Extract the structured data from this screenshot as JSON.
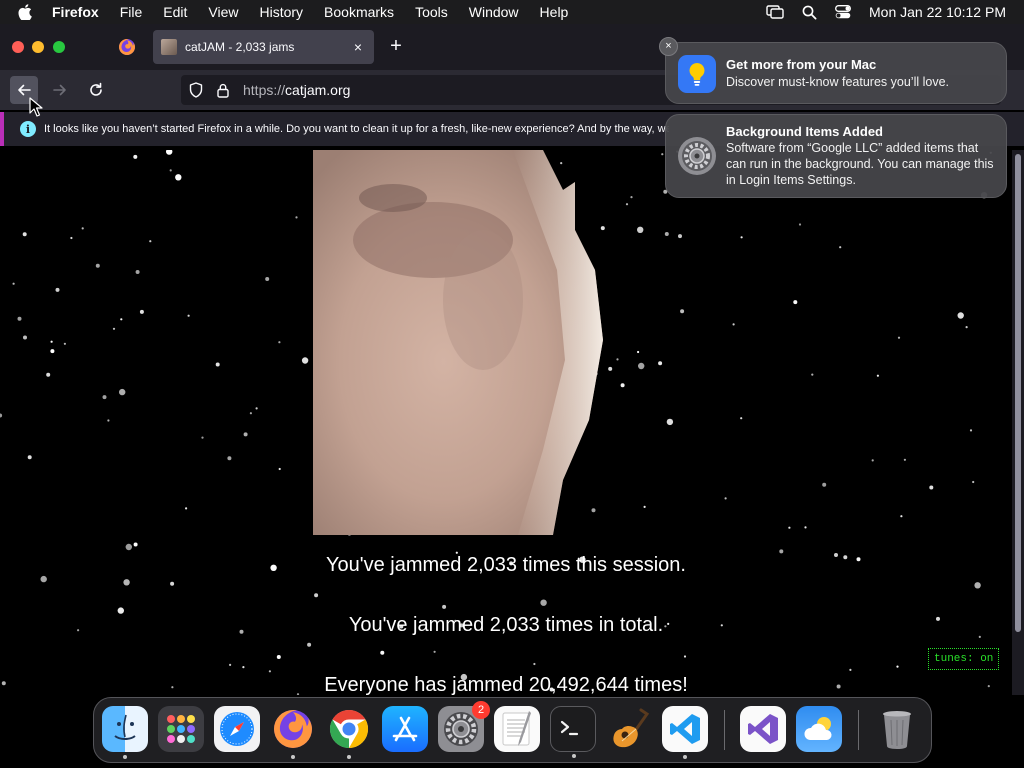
{
  "menubar": {
    "app_name": "Firefox",
    "menus": [
      "File",
      "Edit",
      "View",
      "History",
      "Bookmarks",
      "Tools",
      "Window",
      "Help"
    ],
    "clock": "Mon Jan 22  10:12 PM",
    "status_icons": [
      "screen-mirroring-icon",
      "spotlight-search-icon",
      "control-center-icon"
    ]
  },
  "browser": {
    "tab_title": "catJAM - 2,033 jams",
    "tab_close": "×",
    "new_tab": "+",
    "url_scheme": "https://",
    "url_host": "catjam.org",
    "info_icon": "i",
    "info_message": "It looks like you haven’t started Firefox in a while. Do you want to clean it up for a fresh, like-new experience? And by the way, welcome back!"
  },
  "page": {
    "session_text": "You've jammed 2,033 times this session.",
    "total_text": "You've jammed 2,033 times in total.",
    "everyone_text": "Everyone has jammed 20,492,644 times!",
    "tunes_label": "tunes: on"
  },
  "notifications": [
    {
      "title": "Get more from your Mac",
      "body": "Discover must-know features you’ll love.",
      "icon": "lightbulb-icon"
    },
    {
      "title": "Background Items Added",
      "body": "Software from “Google LLC” added items that can run in the background. You can manage this in Login Items Settings.",
      "icon": "system-settings-gear-icon"
    }
  ],
  "notification_close": "×",
  "dock": {
    "items": [
      "Finder",
      "Launchpad",
      "Safari",
      "Firefox",
      "Google Chrome",
      "App Store",
      "System Settings",
      "TextEdit",
      "Terminal",
      "GarageBand",
      "Visual Studio Code",
      "Visual Studio",
      "Weather",
      "Trash"
    ],
    "system_settings_badge": "2"
  },
  "colors": {
    "menubar_bg": "#1c1c1e",
    "tabbar_bg": "#1c1b22",
    "navbar_bg": "#2b2a33",
    "infobar_accent": "#ba2fb8",
    "tunes_green": "#2ae02a",
    "page_bg": "#000000"
  }
}
